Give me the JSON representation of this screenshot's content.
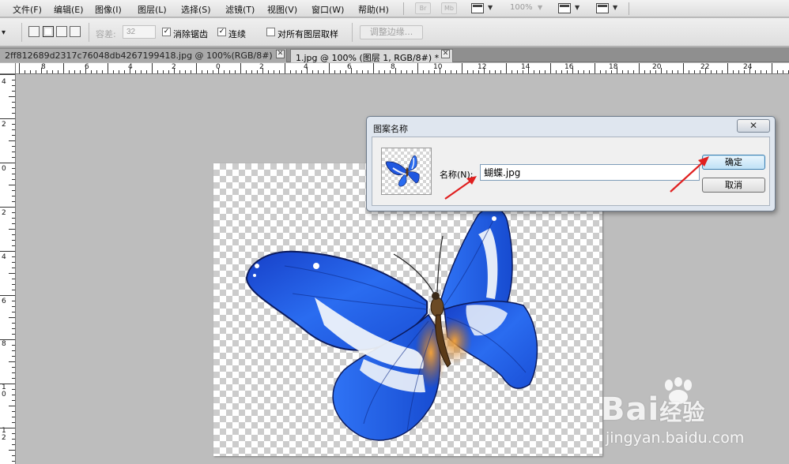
{
  "menubar": {
    "items": [
      "文件(F)",
      "编辑(E)",
      "图像(I)",
      "图层(L)",
      "选择(S)",
      "滤镜(T)",
      "视图(V)",
      "窗口(W)",
      "帮助(H)"
    ],
    "bridge_icon": "Br",
    "minibridge_icon": "Mb",
    "zoom": "100%"
  },
  "optbar": {
    "tolerance_label": "容差:",
    "tolerance_value": "32",
    "antialias_label": "消除锯齿",
    "contiguous_label": "连续",
    "sample_all_label": "对所有图层取样",
    "refine_edge_label": "调整边缘...",
    "check_mark": "✓"
  },
  "tabs": [
    {
      "label": "2ff812689d2317c76048db4267199418.jpg @ 100%(RGB/8#)",
      "close": "✕"
    },
    {
      "label": "1.jpg @ 100% (图层 1, RGB/8#) *",
      "close": "✕"
    }
  ],
  "ruler_top": {
    "numbers": [
      "8",
      "6",
      "4",
      "2",
      "0",
      "2",
      "4",
      "6",
      "8",
      "10",
      "12",
      "14",
      "16",
      "18",
      "20",
      "22",
      "24"
    ]
  },
  "ruler_left": {
    "numbers": [
      "4",
      "2",
      "0",
      "2",
      "4",
      "6",
      "8",
      "10",
      "12"
    ]
  },
  "dialog": {
    "title": "图案名称",
    "close": "✕",
    "name_label": "名称(N):",
    "name_value": "蝴蝶.jpg",
    "ok_label": "确定",
    "cancel_label": "取消"
  },
  "watermark": {
    "brand": "Bai",
    "brand_suffix": "经验",
    "url": "jingyan.baidu.com"
  },
  "colors": {
    "butterfly_blue": "#1f57e0",
    "annotation_red": "#e02020",
    "dialog_bg": "#dfe6ef"
  }
}
